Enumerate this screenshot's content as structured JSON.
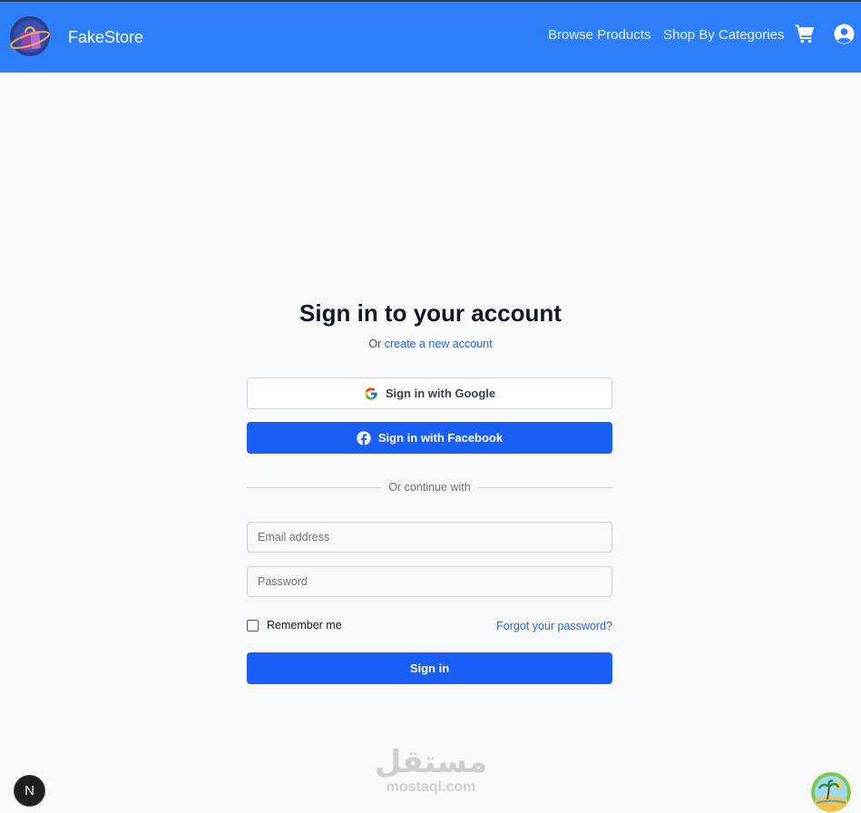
{
  "header": {
    "brand": "FakeStore",
    "nav": {
      "browse_products": "Browse Products",
      "shop_by_categories": "Shop By Categories"
    },
    "icons": [
      "cart-icon",
      "user-circle-icon"
    ],
    "background_color": "#2d7ff9"
  },
  "login": {
    "title": "Sign in to your account",
    "subtitle_prefix": "Or",
    "create_account_link": "create a new account",
    "google_button": "Sign in with Google",
    "facebook_button": "Sign in with Facebook",
    "divider_text": "Or continue with",
    "email_placeholder": "Email address",
    "password_placeholder": "Password",
    "remember_me": "Remember me",
    "forgot_password": "Forgot your password?",
    "sign_in_button": "Sign in"
  },
  "overlay": {
    "next_badge": "N",
    "watermark_arabic": "مستقل",
    "watermark_latin": "mostaql.com"
  },
  "colors": {
    "primary": "#1a5ff5",
    "link": "#2563eb",
    "page_background": "#f8f9fb"
  }
}
